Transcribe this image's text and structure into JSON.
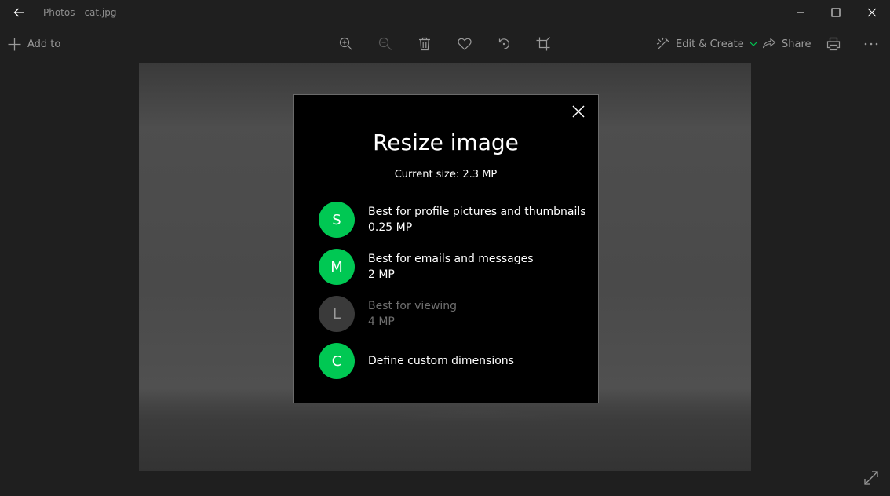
{
  "window": {
    "title": "Photos - cat.jpg"
  },
  "toolbar": {
    "add_to_label": "Add to",
    "edit_create_label": "Edit & Create",
    "share_label": "Share",
    "icons": [
      "zoom-in-icon",
      "zoom-out-icon",
      "delete-icon",
      "heart-icon",
      "rotate-icon",
      "crop-icon",
      "print-icon",
      "more-icon"
    ]
  },
  "dialog": {
    "title": "Resize image",
    "current_size": "Current size: 2.3 MP",
    "options": [
      {
        "letter": "S",
        "label": "Best for profile pictures and thumbnails",
        "size": "0.25 MP",
        "enabled": true,
        "color": "#00c853"
      },
      {
        "letter": "M",
        "label": "Best for emails and messages",
        "size": "2 MP",
        "enabled": true,
        "color": "#00c853"
      },
      {
        "letter": "L",
        "label": "Best for viewing",
        "size": "4 MP",
        "enabled": false,
        "color": "#3a3a3a"
      },
      {
        "letter": "C",
        "label": "Define custom dimensions",
        "size": "",
        "enabled": true,
        "color": "#00c853"
      }
    ]
  },
  "colors": {
    "accent": "#00c853",
    "background": "#1f1f1f",
    "dialog_bg": "#000000",
    "disabled_text": "#6f6f6f"
  }
}
